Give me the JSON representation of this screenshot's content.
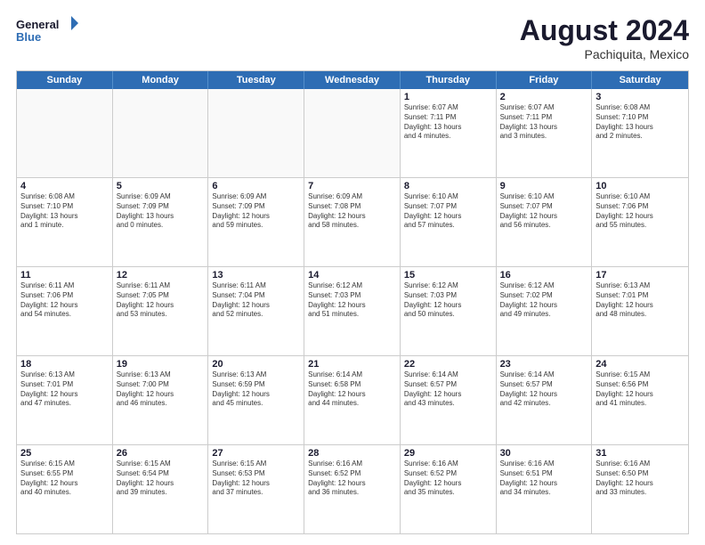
{
  "header": {
    "logo_line1": "General",
    "logo_line2": "Blue",
    "month_year": "August 2024",
    "location": "Pachiquita, Mexico"
  },
  "weekdays": [
    "Sunday",
    "Monday",
    "Tuesday",
    "Wednesday",
    "Thursday",
    "Friday",
    "Saturday"
  ],
  "rows": [
    [
      {
        "day": "",
        "info": ""
      },
      {
        "day": "",
        "info": ""
      },
      {
        "day": "",
        "info": ""
      },
      {
        "day": "",
        "info": ""
      },
      {
        "day": "1",
        "info": "Sunrise: 6:07 AM\nSunset: 7:11 PM\nDaylight: 13 hours\nand 4 minutes."
      },
      {
        "day": "2",
        "info": "Sunrise: 6:07 AM\nSunset: 7:11 PM\nDaylight: 13 hours\nand 3 minutes."
      },
      {
        "day": "3",
        "info": "Sunrise: 6:08 AM\nSunset: 7:10 PM\nDaylight: 13 hours\nand 2 minutes."
      }
    ],
    [
      {
        "day": "4",
        "info": "Sunrise: 6:08 AM\nSunset: 7:10 PM\nDaylight: 13 hours\nand 1 minute."
      },
      {
        "day": "5",
        "info": "Sunrise: 6:09 AM\nSunset: 7:09 PM\nDaylight: 13 hours\nand 0 minutes."
      },
      {
        "day": "6",
        "info": "Sunrise: 6:09 AM\nSunset: 7:09 PM\nDaylight: 12 hours\nand 59 minutes."
      },
      {
        "day": "7",
        "info": "Sunrise: 6:09 AM\nSunset: 7:08 PM\nDaylight: 12 hours\nand 58 minutes."
      },
      {
        "day": "8",
        "info": "Sunrise: 6:10 AM\nSunset: 7:07 PM\nDaylight: 12 hours\nand 57 minutes."
      },
      {
        "day": "9",
        "info": "Sunrise: 6:10 AM\nSunset: 7:07 PM\nDaylight: 12 hours\nand 56 minutes."
      },
      {
        "day": "10",
        "info": "Sunrise: 6:10 AM\nSunset: 7:06 PM\nDaylight: 12 hours\nand 55 minutes."
      }
    ],
    [
      {
        "day": "11",
        "info": "Sunrise: 6:11 AM\nSunset: 7:06 PM\nDaylight: 12 hours\nand 54 minutes."
      },
      {
        "day": "12",
        "info": "Sunrise: 6:11 AM\nSunset: 7:05 PM\nDaylight: 12 hours\nand 53 minutes."
      },
      {
        "day": "13",
        "info": "Sunrise: 6:11 AM\nSunset: 7:04 PM\nDaylight: 12 hours\nand 52 minutes."
      },
      {
        "day": "14",
        "info": "Sunrise: 6:12 AM\nSunset: 7:03 PM\nDaylight: 12 hours\nand 51 minutes."
      },
      {
        "day": "15",
        "info": "Sunrise: 6:12 AM\nSunset: 7:03 PM\nDaylight: 12 hours\nand 50 minutes."
      },
      {
        "day": "16",
        "info": "Sunrise: 6:12 AM\nSunset: 7:02 PM\nDaylight: 12 hours\nand 49 minutes."
      },
      {
        "day": "17",
        "info": "Sunrise: 6:13 AM\nSunset: 7:01 PM\nDaylight: 12 hours\nand 48 minutes."
      }
    ],
    [
      {
        "day": "18",
        "info": "Sunrise: 6:13 AM\nSunset: 7:01 PM\nDaylight: 12 hours\nand 47 minutes."
      },
      {
        "day": "19",
        "info": "Sunrise: 6:13 AM\nSunset: 7:00 PM\nDaylight: 12 hours\nand 46 minutes."
      },
      {
        "day": "20",
        "info": "Sunrise: 6:13 AM\nSunset: 6:59 PM\nDaylight: 12 hours\nand 45 minutes."
      },
      {
        "day": "21",
        "info": "Sunrise: 6:14 AM\nSunset: 6:58 PM\nDaylight: 12 hours\nand 44 minutes."
      },
      {
        "day": "22",
        "info": "Sunrise: 6:14 AM\nSunset: 6:57 PM\nDaylight: 12 hours\nand 43 minutes."
      },
      {
        "day": "23",
        "info": "Sunrise: 6:14 AM\nSunset: 6:57 PM\nDaylight: 12 hours\nand 42 minutes."
      },
      {
        "day": "24",
        "info": "Sunrise: 6:15 AM\nSunset: 6:56 PM\nDaylight: 12 hours\nand 41 minutes."
      }
    ],
    [
      {
        "day": "25",
        "info": "Sunrise: 6:15 AM\nSunset: 6:55 PM\nDaylight: 12 hours\nand 40 minutes."
      },
      {
        "day": "26",
        "info": "Sunrise: 6:15 AM\nSunset: 6:54 PM\nDaylight: 12 hours\nand 39 minutes."
      },
      {
        "day": "27",
        "info": "Sunrise: 6:15 AM\nSunset: 6:53 PM\nDaylight: 12 hours\nand 37 minutes."
      },
      {
        "day": "28",
        "info": "Sunrise: 6:16 AM\nSunset: 6:52 PM\nDaylight: 12 hours\nand 36 minutes."
      },
      {
        "day": "29",
        "info": "Sunrise: 6:16 AM\nSunset: 6:52 PM\nDaylight: 12 hours\nand 35 minutes."
      },
      {
        "day": "30",
        "info": "Sunrise: 6:16 AM\nSunset: 6:51 PM\nDaylight: 12 hours\nand 34 minutes."
      },
      {
        "day": "31",
        "info": "Sunrise: 6:16 AM\nSunset: 6:50 PM\nDaylight: 12 hours\nand 33 minutes."
      }
    ]
  ]
}
